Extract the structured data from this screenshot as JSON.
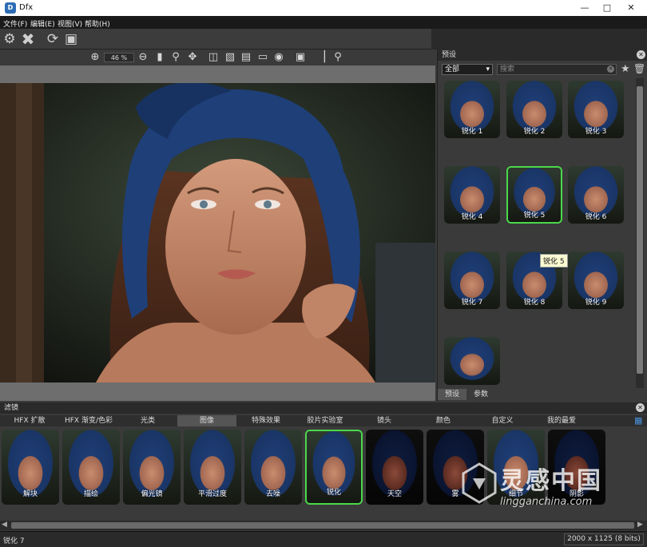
{
  "window": {
    "title": "Dfx",
    "logo_text": "D"
  },
  "menu": [
    "文件(F)",
    "编辑(E)",
    "视图(V)",
    "帮助(H)"
  ],
  "viewer": {
    "zoom": "46 %"
  },
  "presets": {
    "title": "预设",
    "filter_value": "全部",
    "search_placeholder": "搜索",
    "items": [
      "锐化 1",
      "锐化 2",
      "锐化 3",
      "锐化 4",
      "锐化 5",
      "锐化 6",
      "锐化 7",
      "锐化 8",
      "锐化 9"
    ],
    "selected_index": 4,
    "tooltip": "锐化 5",
    "tabs": [
      "预设",
      "参数"
    ]
  },
  "filters": {
    "title": "滤镜",
    "categories": [
      "HFX 扩散",
      "HFX 渐变/色彩",
      "光类",
      "图像",
      "特殊效果",
      "胶片实验室",
      "镜头",
      "颜色",
      "自定义",
      "我的最爱"
    ],
    "active_category_index": 3,
    "items": [
      "解块",
      "描绘",
      "偏光镜",
      "平滑过度",
      "去噪",
      "锐化",
      "天空",
      "雾",
      "细节",
      "阴影"
    ],
    "selected_index": 5
  },
  "status": {
    "left": "锐化 7",
    "right": "2000 x 1125 (8 bits)"
  },
  "watermark": {
    "cn": "灵感中国",
    "url": "lingganchina.com"
  },
  "colors": {
    "selected_border": "#4bd94b",
    "scarf": "#1f3f78"
  }
}
